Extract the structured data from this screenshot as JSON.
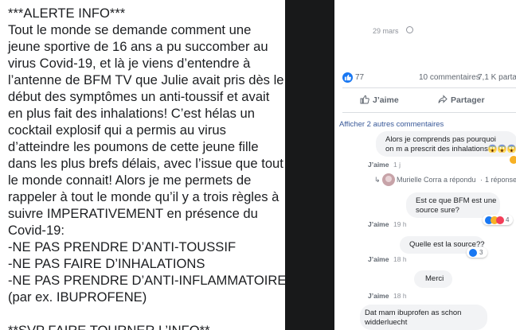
{
  "post": {
    "lines": [
      "***ALERTE INFO***",
      "Tout le monde se demande comment une",
      "jeune sportive de 16 ans a pu succomber au",
      "virus Covid-19, et là je viens d’entendre à",
      "l’antenne de BFM TV que Julie avait pris dès le",
      "début des symptômes un anti-toussif et avait",
      "en plus fait des inhalations! C’est hélas un",
      "cocktail explosif qui a permis au virus",
      "d’atteindre les poumons de cette jeune fille",
      "dans les plus brefs délais, avec l’issue que tout",
      "le monde connait! Alors je me permets de",
      "rappeler à tout le monde qu’il y a trois règles à",
      "suivre IMPERATIVEMENT en présence du",
      "Covid-19:",
      "-NE PAS PRENDRE D’ANTI-TOUSSIF",
      "-NE PAS FAIRE D’INHALATIONS",
      "-NE PAS PRENDRE D’ANTI-INFLAMMATOIRE",
      "(par ex. IBUPROFENE)",
      "",
      "**SVP FAIRE TOURNER L’INFO**"
    ]
  },
  "meta": {
    "timestamp": "29 mars",
    "likes": "77",
    "comments": "10 commentaires",
    "shares": "7,1 K partag"
  },
  "actions": {
    "like": "J’aime",
    "share": "Partager"
  },
  "more_comments": "Afficher 2 autres commentaires",
  "comments": [
    {
      "text": "Alors je comprends pas pourquoi\non m a prescrit des inhalations😱😱😱",
      "like": "J’aime",
      "time": "1 j"
    },
    {
      "reply_author": "Murielle Corra a répondu",
      "reply_sep": "·",
      "reply_count": "1 réponse"
    },
    {
      "text": "Est ce que BFM est une\nsource sure?",
      "like": "J’aime",
      "time": "19 h",
      "reactions": "4"
    },
    {
      "text": "Quelle est la source??",
      "like": "J’aime",
      "time": "18 h",
      "reactions": "3"
    },
    {
      "text": "Merci",
      "like": "J’aime",
      "time": "18 h"
    },
    {
      "text": "Dat mam ibuprofen as schon\nwidderluecht"
    }
  ],
  "colors": {
    "facebook_blue": "#1877f2",
    "link_blue": "#385898",
    "bubble_bg": "#f2f3f5",
    "dark_bg": "#18191a"
  }
}
